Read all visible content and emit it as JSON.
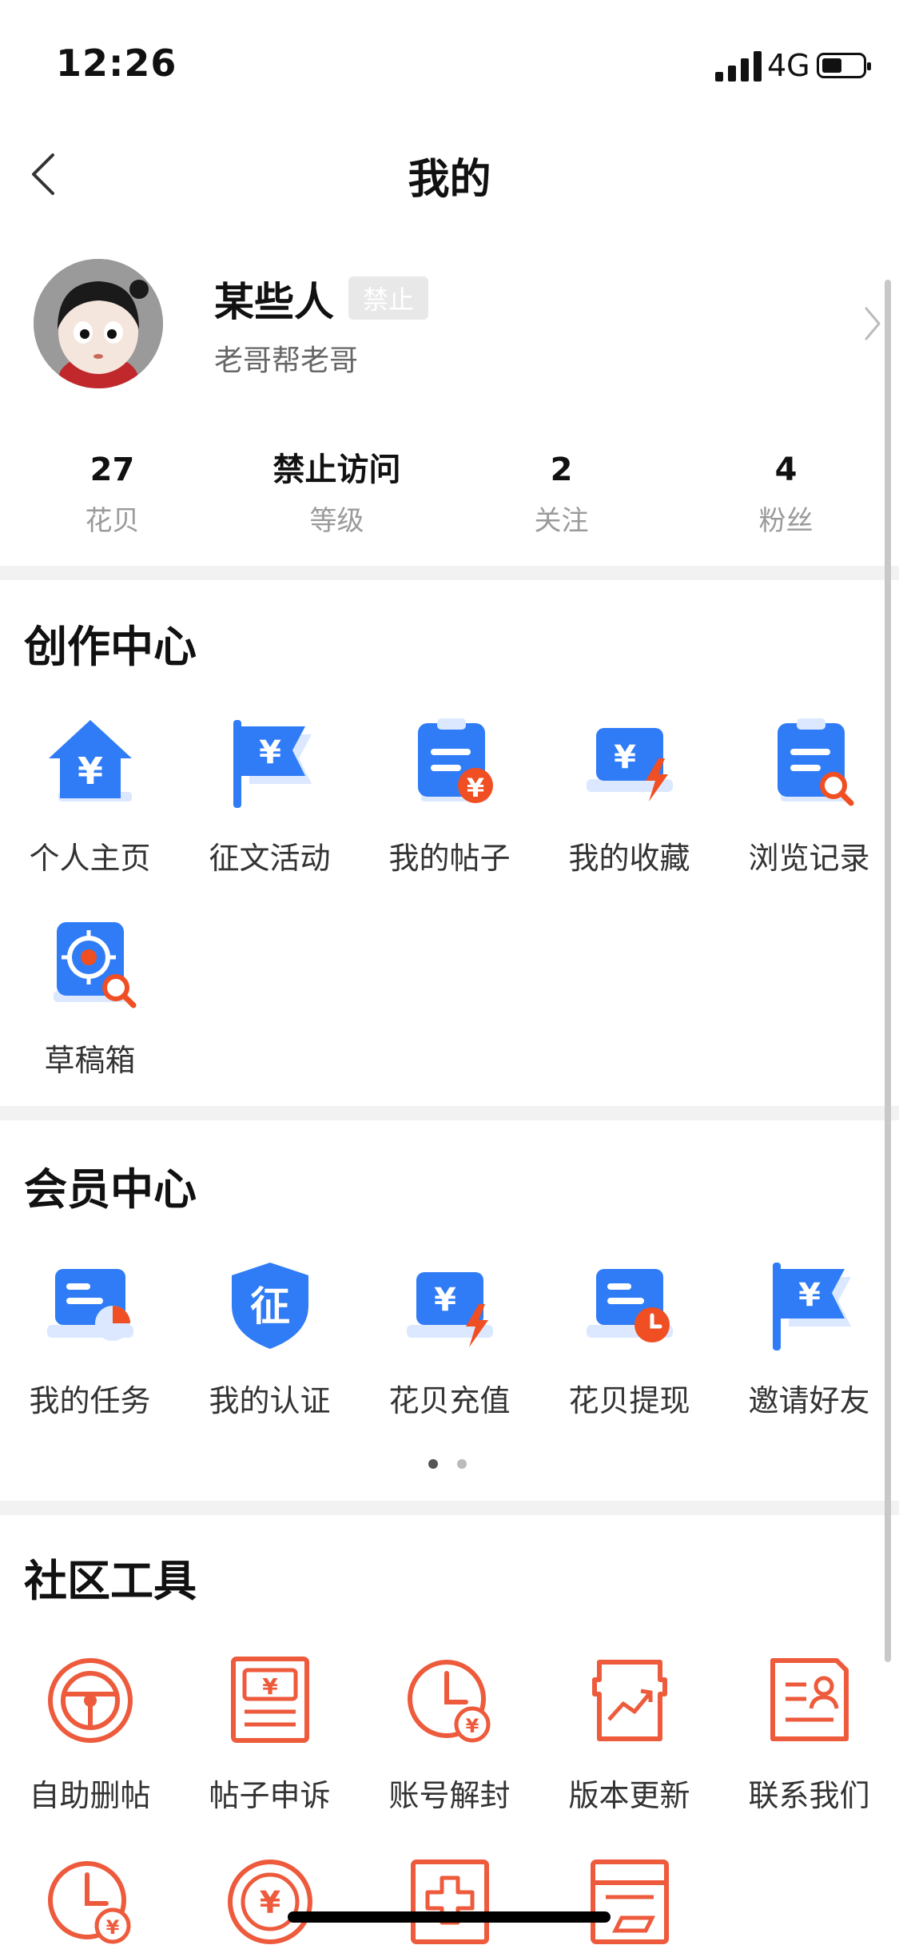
{
  "status": {
    "time": "12:26",
    "network": "4G"
  },
  "nav": {
    "title": "我的"
  },
  "profile": {
    "name": "某些人",
    "badge": "禁止",
    "bio": "老哥帮老哥"
  },
  "stats": [
    {
      "value": "27",
      "label": "花贝"
    },
    {
      "value": "禁止访问",
      "label": "等级"
    },
    {
      "value": "2",
      "label": "关注"
    },
    {
      "value": "4",
      "label": "粉丝"
    }
  ],
  "creation": {
    "title": "创作中心",
    "items": [
      {
        "label": "个人主页",
        "icon": "house-yen-icon"
      },
      {
        "label": "征文活动",
        "icon": "flag-yen-icon"
      },
      {
        "label": "我的帖子",
        "icon": "clipboard-yen-icon"
      },
      {
        "label": "我的收藏",
        "icon": "laptop-bolt-icon"
      },
      {
        "label": "浏览记录",
        "icon": "clipboard-search-icon"
      },
      {
        "label": "草稿箱",
        "icon": "target-search-icon"
      }
    ]
  },
  "member": {
    "title": "会员中心",
    "items": [
      {
        "label": "我的任务",
        "icon": "task-pie-icon"
      },
      {
        "label": "我的认证",
        "icon": "shield-cert-icon"
      },
      {
        "label": "花贝充值",
        "icon": "laptop-yen-bolt-icon"
      },
      {
        "label": "花贝提现",
        "icon": "laptop-clock-icon"
      },
      {
        "label": "邀请好友",
        "icon": "flag-yen-icon"
      }
    ],
    "pager": {
      "pages": 2,
      "current": 1
    }
  },
  "tools": {
    "title": "社区工具",
    "items": [
      {
        "label": "自助删帖",
        "icon": "steering-wheel-icon"
      },
      {
        "label": "帖子申诉",
        "icon": "banknote-icon"
      },
      {
        "label": "账号解封",
        "icon": "clock-yen-icon"
      },
      {
        "label": "版本更新",
        "icon": "chart-frame-icon"
      },
      {
        "label": "联系我们",
        "icon": "contact-card-icon"
      }
    ],
    "row2_icons": [
      "clock-yen-icon",
      "coin-yen-icon",
      "medical-box-icon",
      "card-icon"
    ]
  },
  "colors": {
    "blue": "#2f7cf6",
    "lightBlue": "#dbe8ff",
    "orange": "#f04e23",
    "toolRed": "#ee5a3c",
    "gray": "#9a9a9a"
  }
}
